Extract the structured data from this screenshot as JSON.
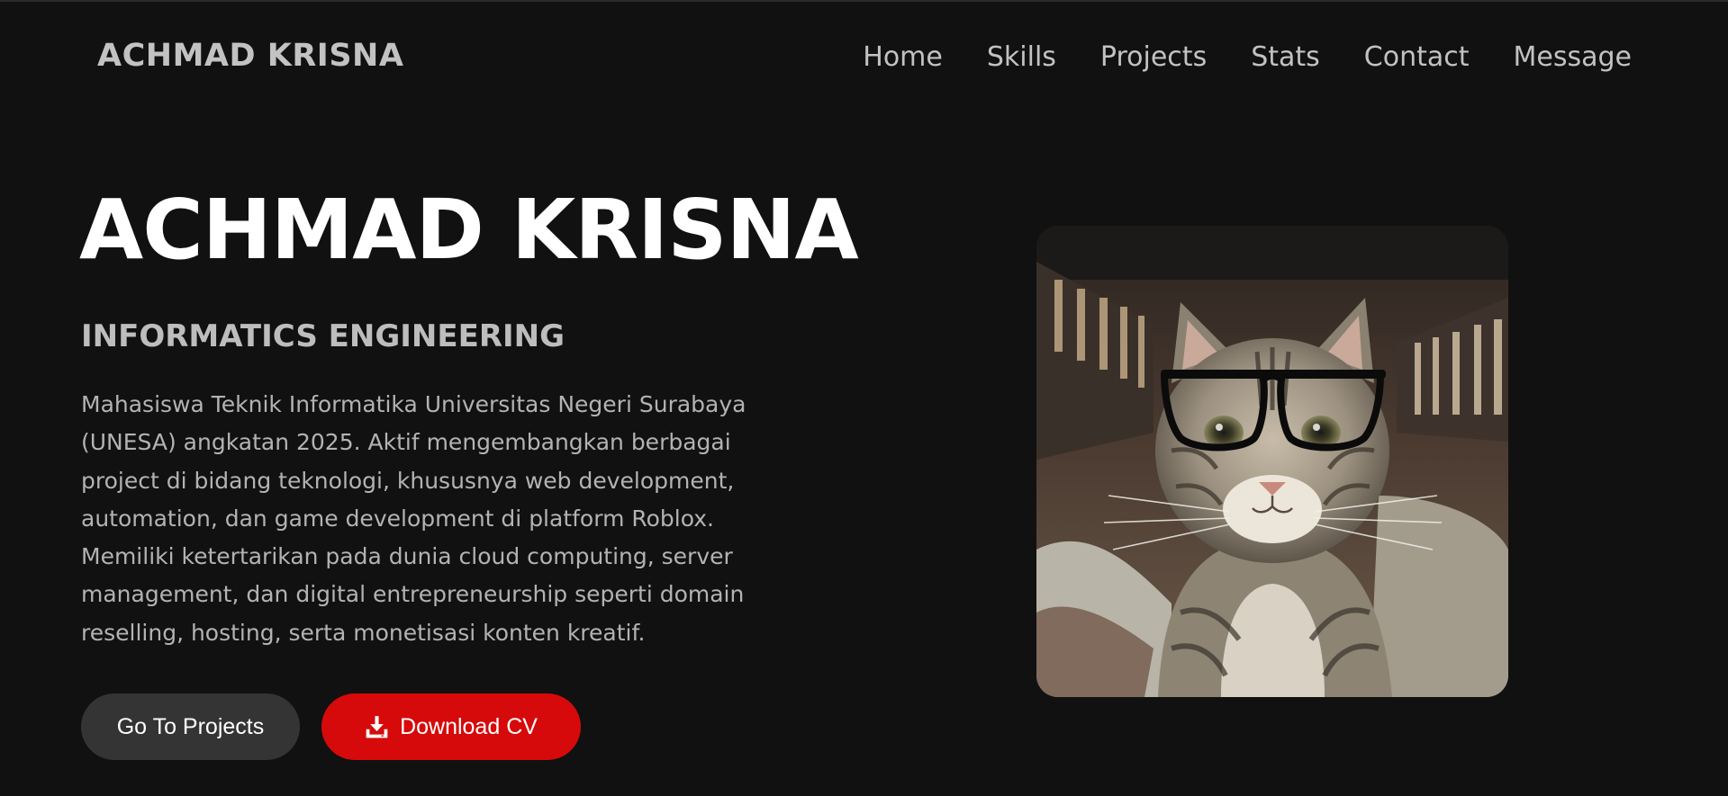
{
  "nav": {
    "brand": "ACHMAD KRISNA",
    "links": [
      "Home",
      "Skills",
      "Projects",
      "Stats",
      "Contact",
      "Message"
    ]
  },
  "hero": {
    "title": "ACHMAD KRISNA",
    "subtitle": "INFORMATICS ENGINEERING",
    "description": "Mahasiswa Teknik Informatika Universitas Negeri Surabaya (UNESA) angkatan 2025. Aktif mengembangkan berbagai project di bidang teknologi, khususnya web development, automation, dan game development di platform Roblox. Memiliki ketertarikan pada dunia cloud computing, server management, dan digital entrepreneurship seperti domain reselling, hosting, serta monetisasi konten kreatif.",
    "buttons": {
      "projects": "Go To Projects",
      "cv": "Download CV",
      "cv_icon": "download-icon"
    }
  },
  "profile_photo": {
    "subject": "cat-with-glasses"
  },
  "colors": {
    "background": "#111111",
    "accent": "#d60a0a",
    "button_secondary": "#343434",
    "text_primary": "#ffffff",
    "text_muted": "#b3b3b3"
  }
}
